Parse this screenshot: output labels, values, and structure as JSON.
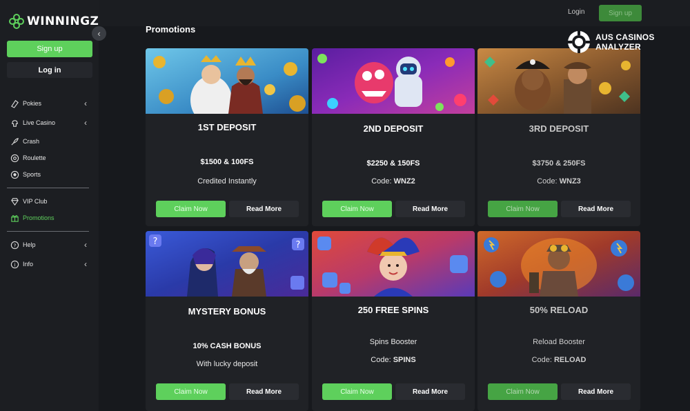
{
  "brand": {
    "name": "WINNINGZ"
  },
  "sidebar": {
    "signup_label": "Sign up",
    "login_label": "Log in",
    "items": [
      {
        "label": "Pokies",
        "icon": "pokies-icon",
        "has_chevron": true
      },
      {
        "label": "Live Casino",
        "icon": "live-casino-icon",
        "has_chevron": true
      },
      {
        "label": "Crash",
        "icon": "rocket-icon"
      },
      {
        "label": "Roulette",
        "icon": "roulette-icon"
      },
      {
        "label": "Sports",
        "icon": "soccer-ball-icon"
      },
      {
        "label": "VIP Club",
        "icon": "diamond-icon"
      },
      {
        "label": "Promotions",
        "icon": "gift-icon",
        "active": true
      },
      {
        "label": "Help",
        "icon": "help-icon",
        "has_chevron": true
      },
      {
        "label": "Info",
        "icon": "info-icon",
        "has_chevron": true
      }
    ]
  },
  "header": {
    "login_label": "Login",
    "signup_label": "Sign up"
  },
  "watermark": {
    "line1": "AUS CASINOS",
    "line2": "ANALYZER"
  },
  "main": {
    "title": "Promotions",
    "cards": [
      {
        "title": "1ST DEPOSIT",
        "amount": "$1500 & 100FS",
        "detail": "Credited Instantly",
        "code_prefix": "",
        "code": "",
        "claim_label": "Claim Now",
        "more_label": "Read More"
      },
      {
        "title": "2ND DEPOSIT",
        "amount": "$2250 & 150FS",
        "detail": "",
        "code_prefix": "Code: ",
        "code": "WNZ2",
        "claim_label": "Claim Now",
        "more_label": "Read More"
      },
      {
        "title": "3RD DEPOSIT",
        "amount": "$3750 & 250FS",
        "detail": "",
        "code_prefix": "Code: ",
        "code": "WNZ3",
        "claim_label": "Claim Now",
        "more_label": "Read More"
      },
      {
        "title": "MYSTERY BONUS",
        "amount": "10% CASH BONUS",
        "detail": "With lucky deposit",
        "code_prefix": "",
        "code": "",
        "claim_label": "Claim Now",
        "more_label": "Read More"
      },
      {
        "title": "250 FREE SPINS",
        "amount": "Spins Booster",
        "detail": "",
        "code_prefix": "Code: ",
        "code": "SPINS",
        "claim_label": "Claim Now",
        "more_label": "Read More"
      },
      {
        "title": "50% RELOAD",
        "amount": "Reload Booster",
        "detail": "",
        "code_prefix": "Code: ",
        "code": "RELOAD",
        "claim_label": "Claim Now",
        "more_label": "Read More"
      }
    ]
  },
  "colors": {
    "accent": "#5ed05c",
    "background": "#17191d",
    "card": "#202226"
  }
}
